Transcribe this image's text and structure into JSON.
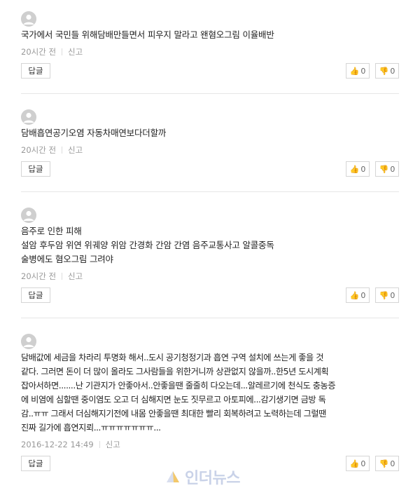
{
  "comments": [
    {
      "lines": [
        "국가에서 국민들 위해담배만들면서 피우지 말라고 왠혐오그림 이율배반"
      ],
      "time": "20시간 전",
      "report": "신고",
      "reply": "답글",
      "likes": "0",
      "dislikes": "0"
    },
    {
      "lines": [
        "담배흡연공기오염 자동차매연보다더할까"
      ],
      "time": "20시간 전",
      "report": "신고",
      "reply": "답글",
      "likes": "0",
      "dislikes": "0"
    },
    {
      "lines": [
        "음주로 인한 피해",
        "설암 후두암 위연 위궤양 위암 간경화 간암 간염 음주교통사고 알콜중독",
        "술병에도 혐오그림 그려야"
      ],
      "time": "20시간 전",
      "report": "신고",
      "reply": "답글",
      "likes": "0",
      "dislikes": "0"
    },
    {
      "lines": [
        "담배값에 세금을 차라리 투명화 해서..도시 공기청정기과 흡연 구역 설치에 쓰는게 좋을 것",
        "같다. 그러면 돈이 더 많이 올라도 그사람들을 위한거니까 상관없지 않을까..한5년 도시계획",
        "잡아서하면.......난 기관지가 안좋아서..안좋을땐 줄줄히 다오는데...알레르기에 천식도 충농증",
        "에 비염에 심할땐 중이염도 오고 더 심해지면 눈도 짓무르고 아토피에...감기생기면 금방 독",
        "감..ㅠㅠ 그래서 더심해지기전에 내몸 안좋을땐 최대한 빨리 회복하려고 노력하는데 그럴땐",
        "진짜 길가에 흡연지뢰...ㅠㅠㅠㅠㅠㅠㅠ..."
      ],
      "time": "2016-12-22 14:49",
      "report": "신고",
      "reply": "답글",
      "likes": "0",
      "dislikes": "0"
    }
  ],
  "watermark": "인더뉴스",
  "icons": {
    "avatar": "user-avatar-icon",
    "up": "thumbs-up-icon",
    "down": "thumbs-down-icon"
  },
  "colors": {
    "divider": "#e6e6e6",
    "meta": "#999999",
    "border": "#d5d5d5"
  }
}
